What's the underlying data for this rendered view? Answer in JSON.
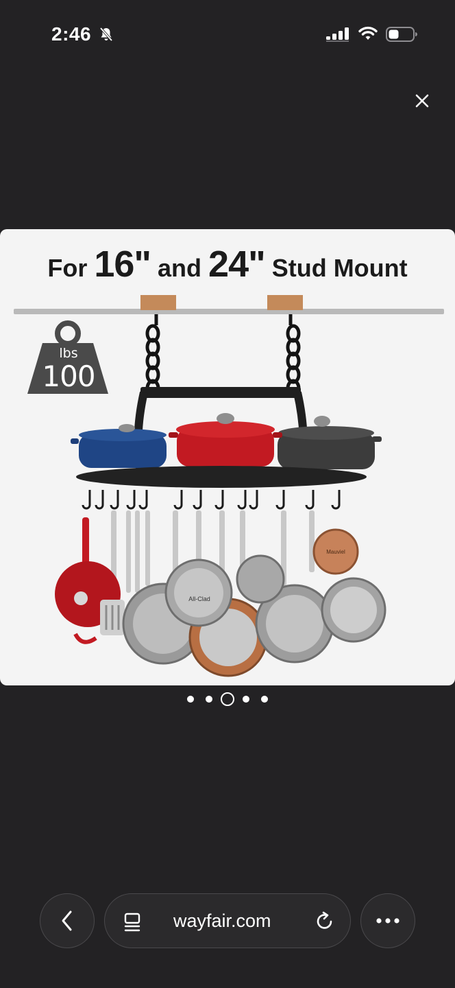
{
  "status_bar": {
    "time": "2:46",
    "icons": [
      "bell-slash-icon",
      "signal-icon",
      "wifi-icon",
      "battery-icon"
    ]
  },
  "viewer": {
    "close_icon": "close-icon",
    "image": {
      "headline_prefix": "For ",
      "headline_num1": "16\"",
      "headline_mid": " and ",
      "headline_num2": "24\"",
      "headline_suffix": " Stud Mount",
      "weight_unit": "lbs",
      "weight_value": "100",
      "brand_mark_1": "All-Clad",
      "brand_mark_2": "Mauviel"
    },
    "pager": {
      "count": 5,
      "active_index": 2
    }
  },
  "toolbar": {
    "back_icon": "chevron-left-icon",
    "reader_icon": "reader-icon",
    "url": "wayfair.com",
    "reload_icon": "reload-icon",
    "more_icon": "more-dots-icon"
  },
  "colors": {
    "background": "#232224",
    "image_background": "#f4f4f4",
    "toolbar_button": "#2b2a2c"
  }
}
